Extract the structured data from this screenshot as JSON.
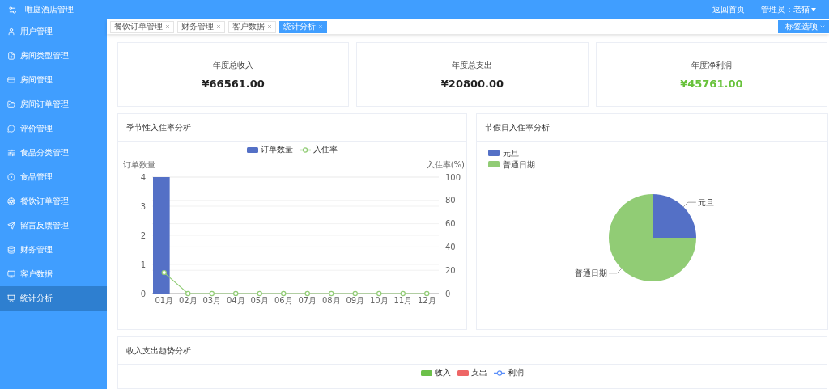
{
  "app": {
    "title": "唯庭酒店管理"
  },
  "header": {
    "links": [
      {
        "label": "返回首页"
      },
      {
        "label": "管理员：老猫"
      }
    ]
  },
  "sidebar": {
    "items": [
      {
        "label": "用户管理",
        "selected": false
      },
      {
        "label": "房间类型管理",
        "selected": false
      },
      {
        "label": "房间管理",
        "selected": false
      },
      {
        "label": "房间订单管理",
        "selected": false
      },
      {
        "label": "评价管理",
        "selected": false
      },
      {
        "label": "食品分类管理",
        "selected": false
      },
      {
        "label": "食品管理",
        "selected": false
      },
      {
        "label": "餐饮订单管理",
        "selected": false
      },
      {
        "label": "留言反馈管理",
        "selected": false
      },
      {
        "label": "财务管理",
        "selected": false
      },
      {
        "label": "客户数据",
        "selected": false
      },
      {
        "label": "统计分析",
        "selected": true
      }
    ]
  },
  "tabs": {
    "items": [
      {
        "label": "餐饮订单管理",
        "selected": false
      },
      {
        "label": "财务管理",
        "selected": false
      },
      {
        "label": "客户数据",
        "selected": false
      },
      {
        "label": "统计分析",
        "selected": true
      }
    ],
    "options_button": "标签选项"
  },
  "stats": [
    {
      "label": "年度总收入",
      "value": "¥66561.00",
      "kind": "plain"
    },
    {
      "label": "年度总支出",
      "value": "¥20800.00",
      "kind": "plain"
    },
    {
      "label": "年度净利润",
      "value": "¥45761.00",
      "kind": "positive"
    }
  ],
  "seasonal": {
    "title": "季节性入住率分析",
    "chart_data": {
      "type": "bar",
      "categories": [
        "01月",
        "02月",
        "03月",
        "04月",
        "05月",
        "06月",
        "07月",
        "08月",
        "09月",
        "10月",
        "11月",
        "12月"
      ],
      "series": [
        {
          "name": "订单数量",
          "color": "#5470c6",
          "type": "bar",
          "values": [
            4,
            0,
            0,
            0,
            0,
            0,
            0,
            0,
            0,
            0,
            0,
            0
          ]
        },
        {
          "name": "入住率",
          "color": "#91cc75",
          "type": "line",
          "axis": "y2",
          "marker": "circle",
          "values": [
            18,
            0,
            0,
            0,
            0,
            0,
            0,
            0,
            0,
            0,
            0,
            0
          ]
        }
      ],
      "ylabel": "订单数量",
      "y2label": "入住率(%)",
      "ylim": [
        0,
        4
      ],
      "y2lim": [
        0,
        100
      ],
      "yticks": [
        0,
        1,
        2,
        3,
        4
      ],
      "y2ticks": [
        0,
        20,
        40,
        60,
        80,
        100
      ],
      "grid": true
    }
  },
  "holiday": {
    "title": "节假日入住率分析",
    "chart_data": {
      "type": "pie",
      "categories": [
        "元旦",
        "普通日期"
      ],
      "values": [
        25,
        75
      ],
      "colors": [
        "#5470c6",
        "#91cc75"
      ],
      "legend": "top-left"
    }
  },
  "trend": {
    "title": "收入支出趋势分析",
    "legend": [
      {
        "label": "收入",
        "color": "#6cc04a",
        "kind": "box"
      },
      {
        "label": "支出",
        "color": "#ee6666",
        "kind": "box"
      },
      {
        "label": "利润",
        "color": "#5b8ff9",
        "kind": "line"
      }
    ]
  }
}
